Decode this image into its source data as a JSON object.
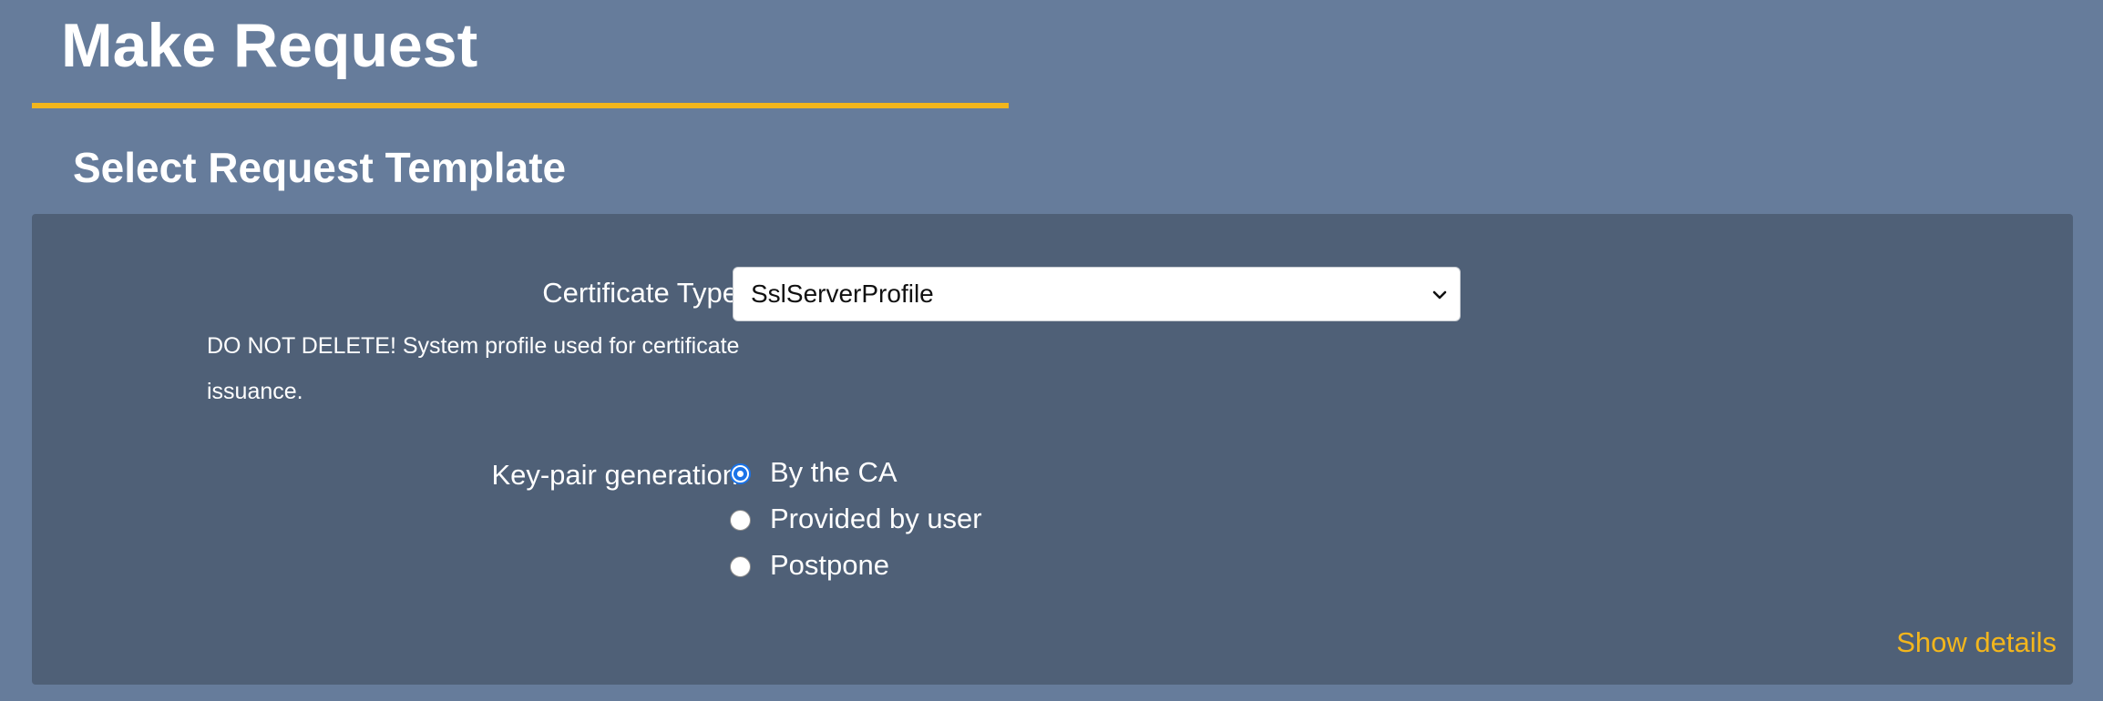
{
  "header": {
    "title": "Make Request",
    "accent_color": "#f3b61c"
  },
  "section": {
    "title": "Select Request Template"
  },
  "form": {
    "certificate_type": {
      "label": "Certificate Type",
      "selected": "SslServerProfile",
      "description": "DO NOT DELETE! System profile used for certificate issuance."
    },
    "key_pair": {
      "label": "Key-pair generation",
      "options": [
        {
          "label": "By the CA",
          "checked": true
        },
        {
          "label": "Provided by user",
          "checked": false
        },
        {
          "label": "Postpone",
          "checked": false
        }
      ]
    },
    "show_details_label": "Show details"
  },
  "colors": {
    "background": "#667c9b",
    "panel": "#4f6077",
    "link": "#f3b61c",
    "radio_selected": "#1a73e8"
  },
  "icons": {
    "select_arrow": "chevron-down-icon"
  }
}
